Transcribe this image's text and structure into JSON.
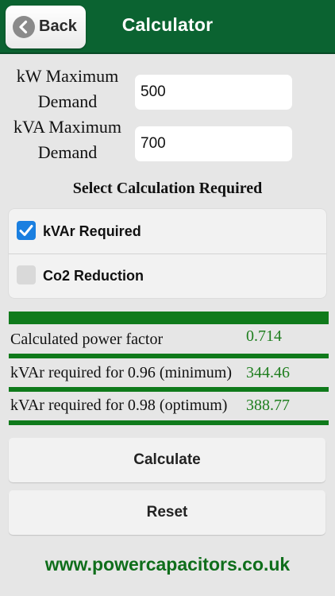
{
  "header": {
    "title": "Calculator",
    "back_label": "Back",
    "back_icon": "chevron-left-icon",
    "color": "#0b6331"
  },
  "inputs": {
    "kw_label_line1": "kW Maximum",
    "kw_label_line2": "Demand",
    "kw_value": "500",
    "kva_label_line1": "kVA Maximum",
    "kva_label_line2": "Demand",
    "kva_value": "700"
  },
  "selection": {
    "title": "Select Calculation Required",
    "options": [
      {
        "label": "kVAr Required",
        "checked": true
      },
      {
        "label": "Co2 Reduction",
        "checked": false
      }
    ],
    "check_color": "#1a7fe0"
  },
  "results": {
    "rows": [
      {
        "label": "Calculated power factor",
        "value": "0.714"
      },
      {
        "label": "kVAr required for 0.96 (minimum)",
        "value": "344.46"
      },
      {
        "label": "kVAr required for 0.98 (optimum)",
        "value": "388.77"
      }
    ],
    "value_color": "#1e7e1e",
    "bar_color": "#0f7a1b"
  },
  "buttons": {
    "calculate": "Calculate",
    "reset": "Reset"
  },
  "footer": {
    "website": "www.powercapacitors.co.uk"
  }
}
